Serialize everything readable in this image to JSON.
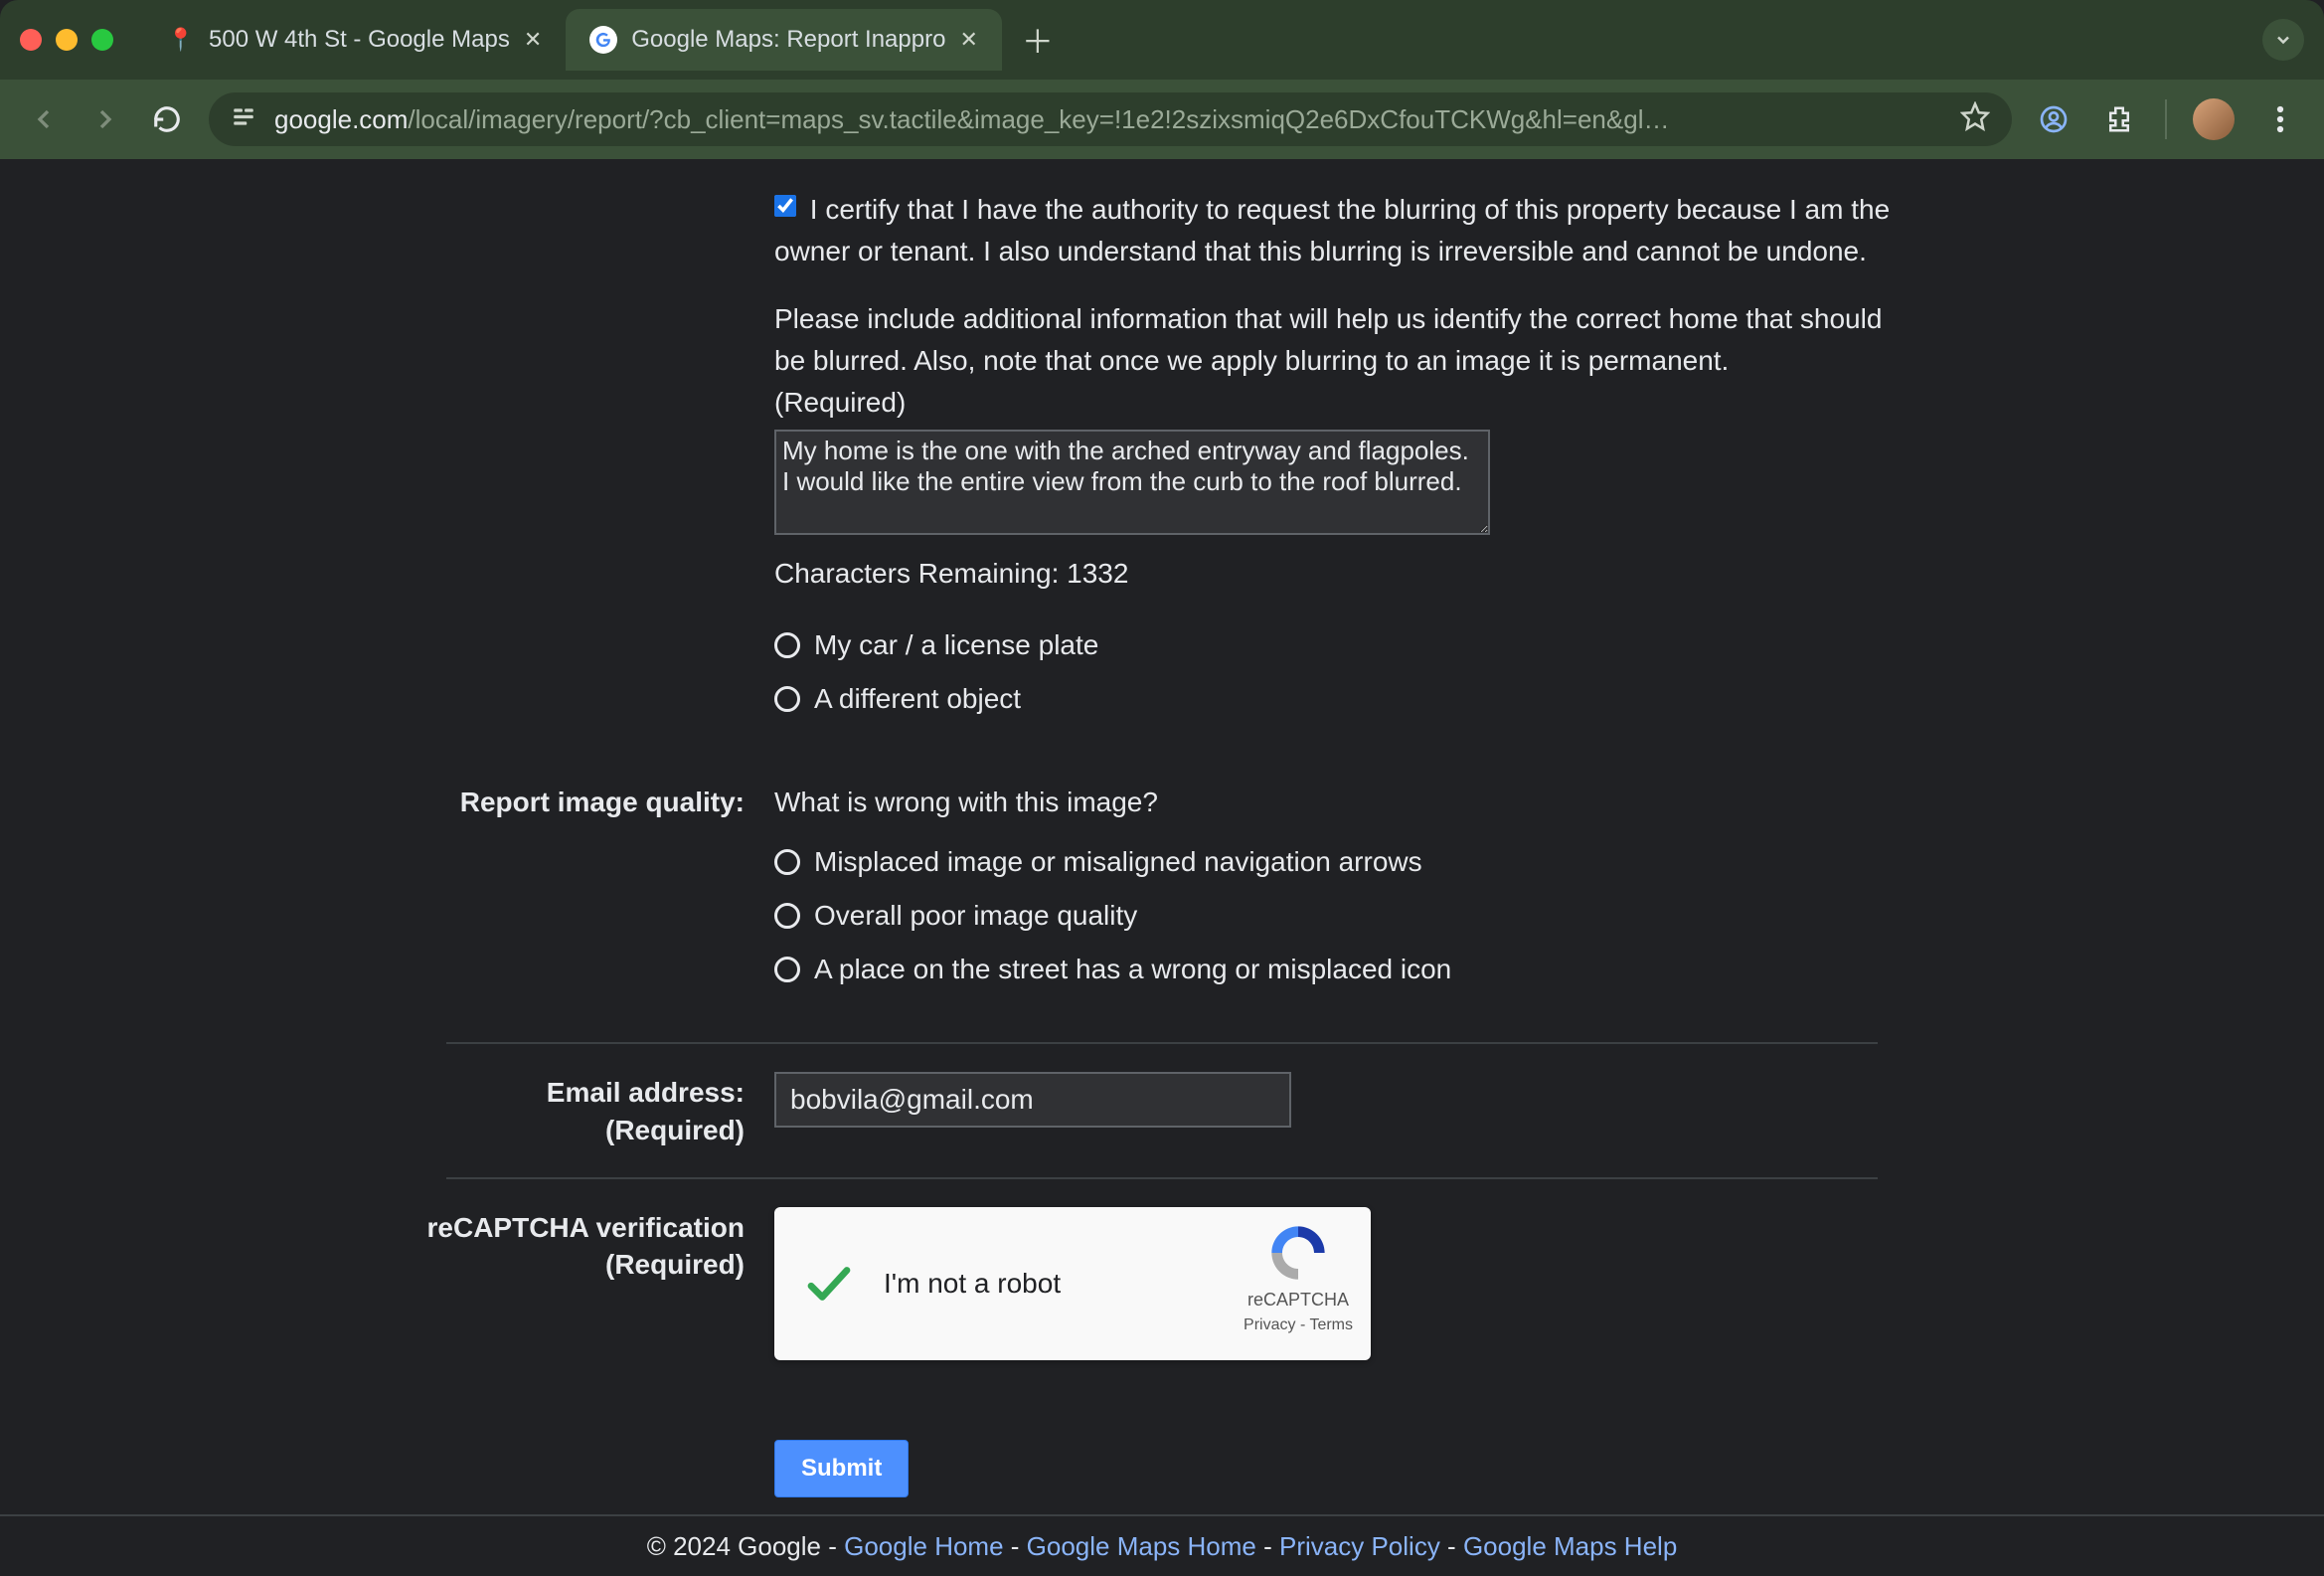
{
  "browser": {
    "tabs": [
      {
        "title": "500 W 4th St - Google Maps",
        "active": false
      },
      {
        "title": "Google Maps: Report Inappro",
        "active": true
      }
    ],
    "url_host": "google.com",
    "url_path": "/local/imagery/report/?cb_client=maps_sv.tactile&image_key=!1e2!2szixsmiqQ2e6DxCfouTCKWg&hl=en&gl…"
  },
  "form": {
    "certify_checked": true,
    "certify_text": "I certify that I have the authority to request the blurring of this property because I am the owner or tenant. I also understand that this blurring is irreversible and cannot be undone.",
    "instructions": "Please include additional information that will help us identify the correct home that should be blurred. Also, note that once we apply blurring to an image it is permanent.",
    "required_label": "(Required)",
    "additional_info_value": "My home is the one with the arched entryway and flagpoles. I would like the entire view from the curb to the roof blurred.",
    "chars_remaining_label": "Characters Remaining: 1332",
    "blur_radios": [
      "My car / a license plate",
      "A different object"
    ],
    "quality_section_label": "Report image quality:",
    "quality_question": "What is wrong with this image?",
    "quality_radios": [
      "Misplaced image or misaligned navigation arrows",
      "Overall poor image quality",
      "A place on the street has a wrong or misplaced icon"
    ],
    "email_label": "Email address:",
    "email_required": "(Required)",
    "email_value": "bobvila@gmail.com",
    "recaptcha_label_1": "reCAPTCHA verification",
    "recaptcha_label_2": "(Required)",
    "recaptcha_text": "I'm not a robot",
    "recaptcha_brand": "reCAPTCHA",
    "recaptcha_privacy": "Privacy",
    "recaptcha_terms": "Terms",
    "submit_label": "Submit"
  },
  "footer": {
    "copyright": "© 2024 Google",
    "links": [
      "Google Home",
      "Google Maps Home",
      "Privacy Policy",
      "Google Maps Help"
    ]
  }
}
